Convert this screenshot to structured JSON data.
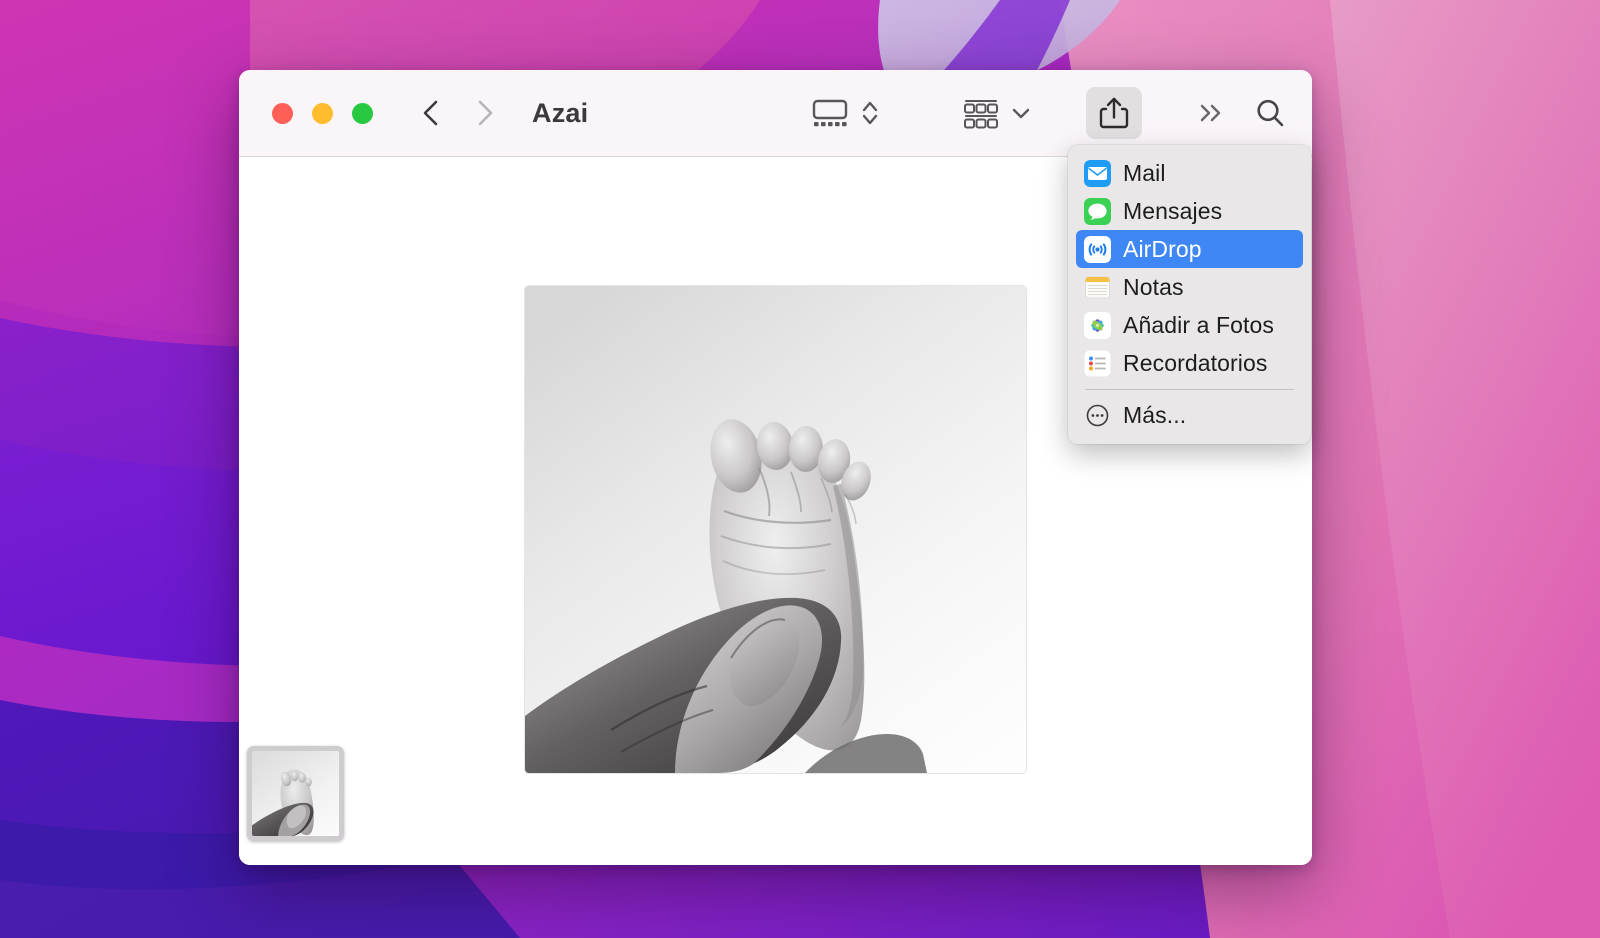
{
  "desktop": {
    "wallpaper_name": "monterey-gradient-wallpaper",
    "colors": {
      "magenta": "#c52bb0",
      "pink": "#e06fb4",
      "pink_light": "#e58cc0",
      "purple": "#9b2fd0",
      "violet": "#6b18cf",
      "indigo": "#4c18b8",
      "deep_indigo": "#3a1ba8",
      "lavender": "#cdc3e6"
    }
  },
  "window": {
    "title": "Azai",
    "app": "preview",
    "traffic_lights": [
      {
        "name": "close",
        "color": "#ff5f57"
      },
      {
        "name": "minimize",
        "color": "#febc2e"
      },
      {
        "name": "maximize",
        "color": "#28c840"
      }
    ],
    "nav": {
      "back_icon": "chevron-left-icon",
      "forward_icon": "chevron-right-icon",
      "back_enabled": true,
      "forward_enabled": false
    },
    "toolbar": {
      "items": [
        {
          "name": "view-contact-sheet",
          "icon": "contact-sheet-icon"
        },
        {
          "name": "page-stepper",
          "icon": "chevron-up-down-icon"
        },
        {
          "name": "markup-tools",
          "icon": "grid-rows-icon"
        },
        {
          "name": "markup-dropdown",
          "icon": "chevron-down-icon"
        },
        {
          "name": "share",
          "icon": "share-icon",
          "active": true
        },
        {
          "name": "overflow",
          "icon": "double-chevron-right-icon"
        },
        {
          "name": "search",
          "icon": "search-icon"
        }
      ]
    },
    "content": {
      "photo_alt": "black-and-white-photo-of-baby-foot-held-by-adult-hand",
      "thumbnail_alt": "photo-thumbnail-baby-foot"
    }
  },
  "share_menu": {
    "open": true,
    "highlight_color": "#3f87f5",
    "background_color": "#e9e7e8",
    "items": [
      {
        "label": "Mail",
        "icon": "mail-app-icon",
        "selected": false
      },
      {
        "label": "Mensajes",
        "icon": "messages-app-icon",
        "selected": false
      },
      {
        "label": "AirDrop",
        "icon": "airdrop-icon",
        "selected": true
      },
      {
        "label": "Notas",
        "icon": "notes-app-icon",
        "selected": false
      },
      {
        "label": "Añadir a Fotos",
        "icon": "photos-app-icon",
        "selected": false
      },
      {
        "label": "Recordatorios",
        "icon": "reminders-app-icon",
        "selected": false
      }
    ],
    "more": {
      "label": "Más...",
      "icon": "ellipsis-circle-icon"
    }
  }
}
